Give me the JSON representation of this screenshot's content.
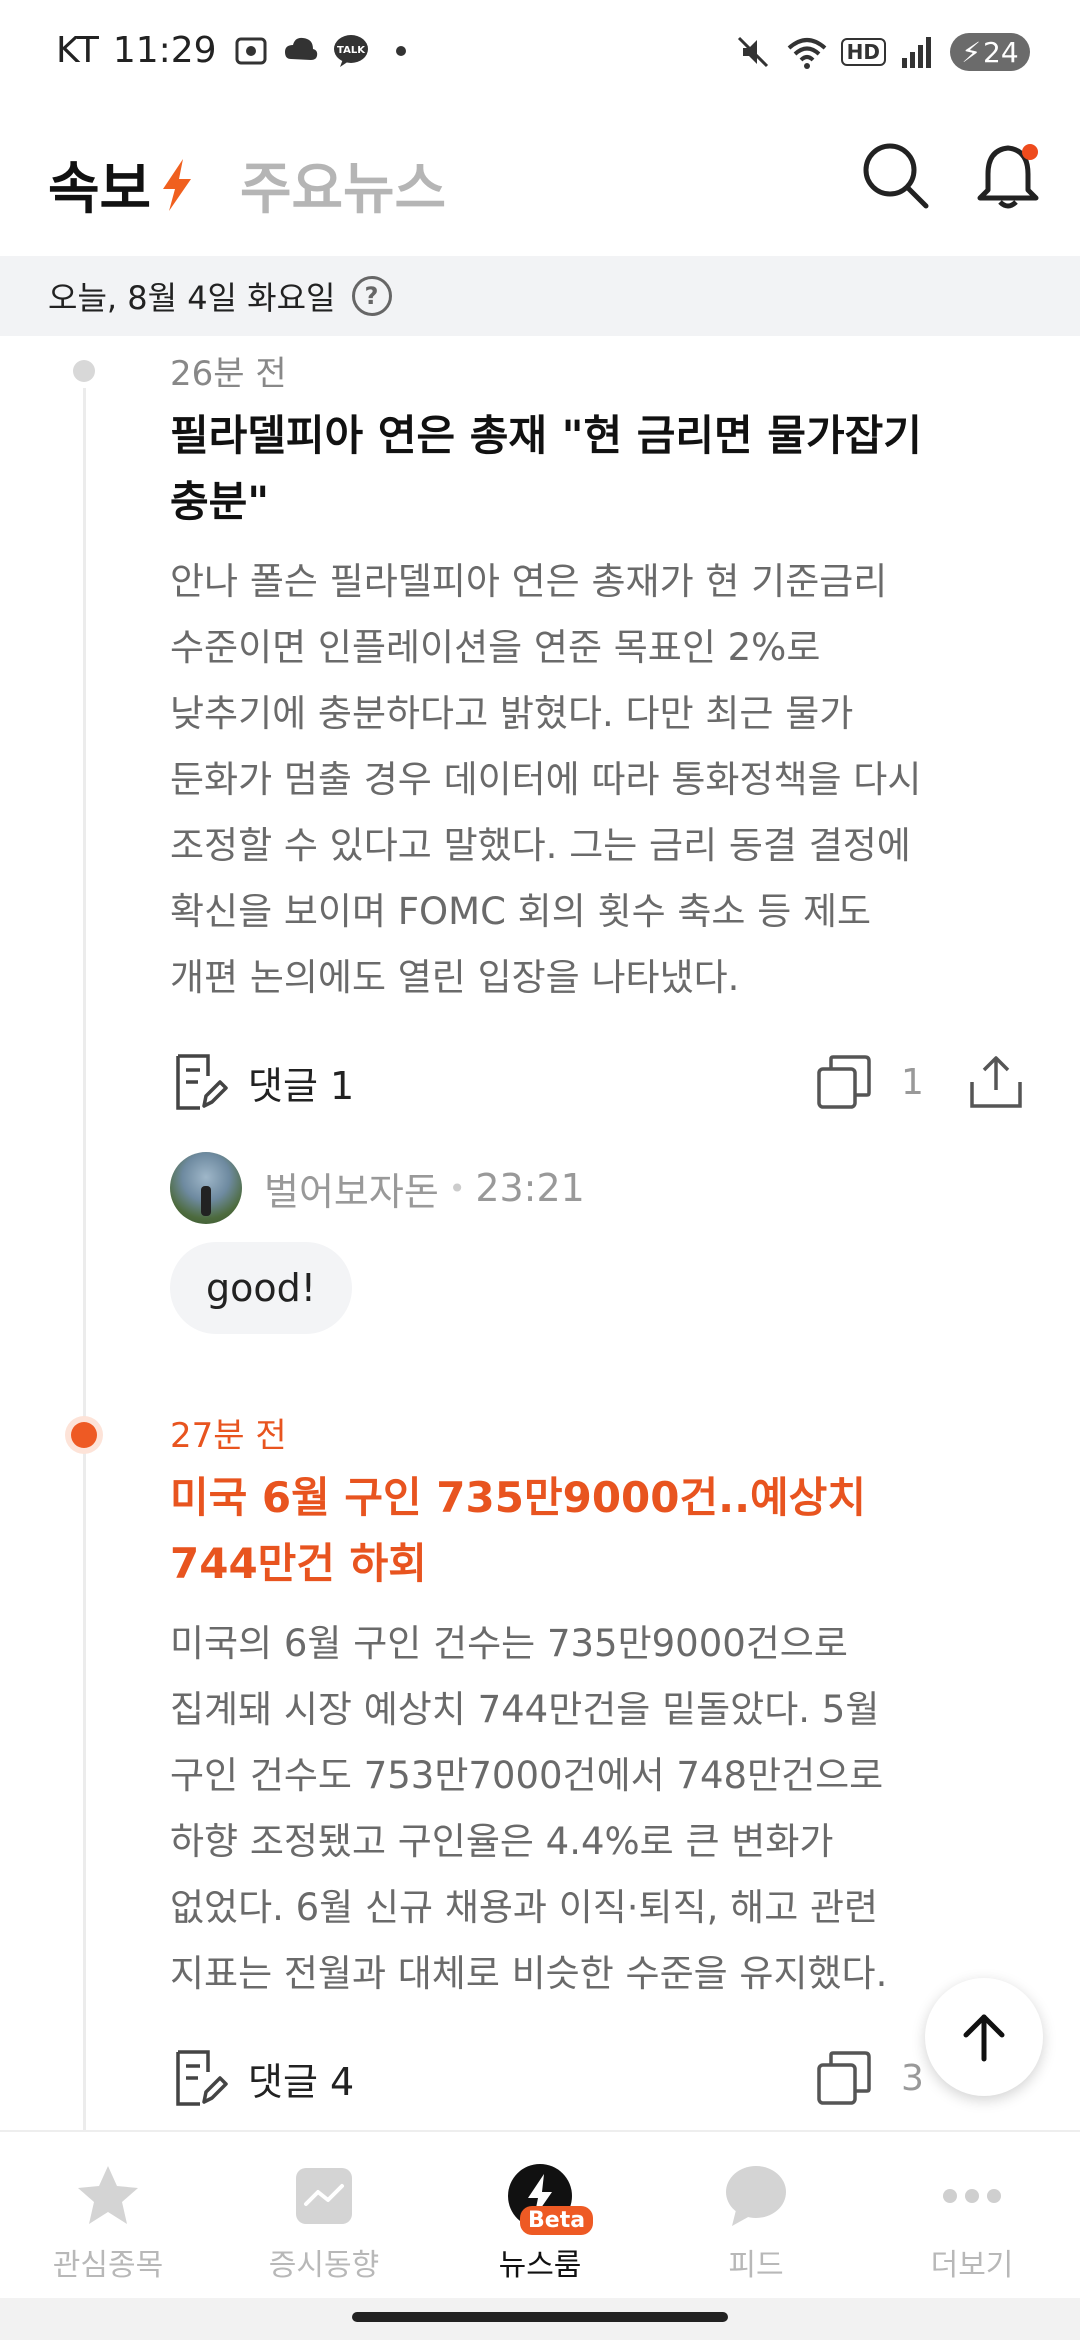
{
  "status_bar": {
    "carrier": "KT",
    "time": "11:29",
    "network_label": "HD",
    "battery_level": "24",
    "talk_badge": "TALK"
  },
  "header": {
    "tab_breaking": "속보",
    "tab_major": "주요뉴스"
  },
  "date_bar": {
    "date": "오늘, 8월 4일 화요일",
    "help_glyph": "?"
  },
  "articles": [
    {
      "time": "26분 전",
      "headline_line1": "필라델피아 연은 총재 \"현 금리면 물가잡기",
      "headline_line2": "충분\"",
      "body_lines": [
        "안나 폴슨 필라델피아 연은 총재가 현 기준금리",
        "수준이면 인플레이션을 연준 목표인 2%로",
        "낮추기에 충분하다고 밝혔다. 다만 최근 물가",
        "둔화가 멈출 경우 데이터에 따라 통화정책을 다시",
        "조정할 수 있다고 말했다. 그는 금리 동결 결정에",
        "확신을 보이며 FOMC 회의 횟수 축소 등 제도",
        "개편 논의에도 열린 입장을 나타냈다."
      ],
      "comment_label": "댓글 1",
      "copy_count": "1",
      "comment": {
        "author": "벌어보자돈",
        "separator": "•",
        "time": "23:21",
        "text": "good!"
      }
    },
    {
      "time": "27분 전",
      "headline_line1": "미국 6월 구인 735만9000건..예상치",
      "headline_line2": "744만건 하회",
      "body_lines": [
        "미국의 6월 구인 건수는 735만9000건으로",
        "집계돼 시장 예상치 744만건을 밑돌았다. 5월",
        "구인 건수도 753만7000건에서 748만건으로",
        "하향 조정됐고 구인율은 4.4%로 큰 변화가",
        "없었다. 6월 신규 채용과 이직·퇴직, 해고 관련",
        "지표는 전월과 대체로 비슷한 수준을 유지했다."
      ],
      "comment_label": "댓글 4",
      "copy_count": "3"
    }
  ],
  "bottom_nav": {
    "items": [
      {
        "label": "관심종목",
        "icon": "star-icon"
      },
      {
        "label": "증시동향",
        "icon": "chart-icon"
      },
      {
        "label": "뉴스룸",
        "icon": "lightning-icon",
        "badge": "Beta"
      },
      {
        "label": "피드",
        "icon": "chat-bubble-icon"
      },
      {
        "label": "더보기",
        "icon": "more-dots-icon"
      }
    ]
  },
  "colors": {
    "accent": "#e8541f",
    "inactive": "#b8b8b8"
  }
}
